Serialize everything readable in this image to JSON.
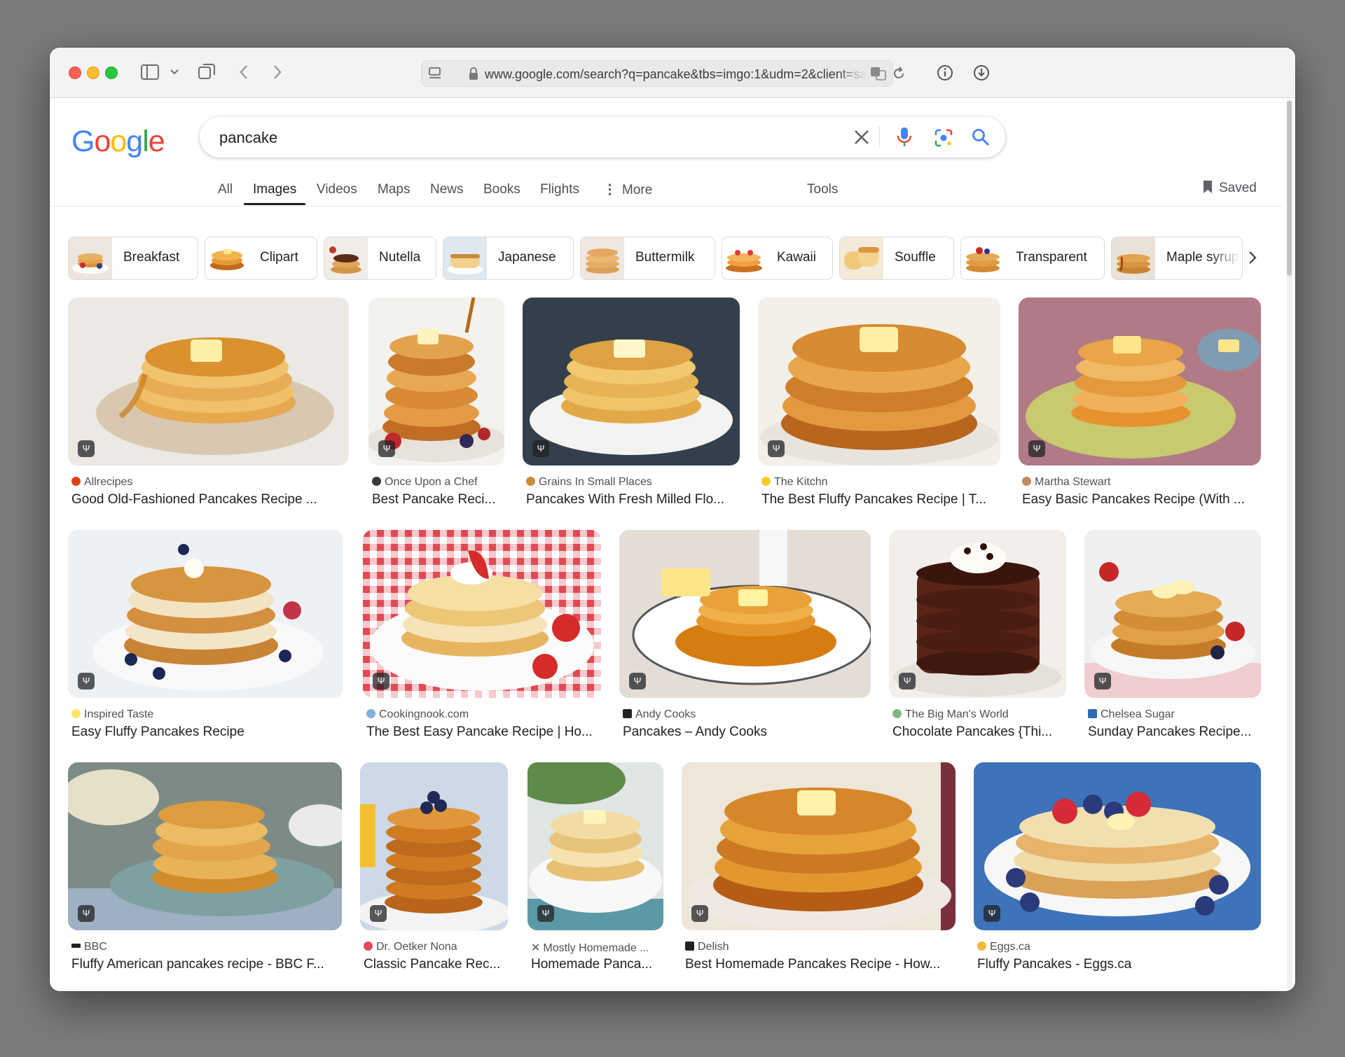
{
  "browser": {
    "url": "www.google.com/search?q=pancake&tbs=imgo:1&udm=2&client=sa"
  },
  "search": {
    "logo": [
      "G",
      "o",
      "o",
      "g",
      "l",
      "e"
    ],
    "query": "pancake"
  },
  "tabs": [
    "All",
    "Images",
    "Videos",
    "Maps",
    "News",
    "Books",
    "Flights",
    "More",
    "Tools"
  ],
  "saved_label": "Saved",
  "chips": [
    "Breakfast",
    "Clipart",
    "Nutella",
    "Japanese",
    "Buttermilk",
    "Kawaii",
    "Souffle",
    "Transparent",
    "Maple syrup"
  ],
  "results": [
    {
      "source": "Allrecipes",
      "title": "Good Old-Fashioned Pancakes Recipe ..."
    },
    {
      "source": "Once Upon a Chef",
      "title": "Best Pancake Reci..."
    },
    {
      "source": "Grains In Small Places",
      "title": "Pancakes With Fresh Milled Flo..."
    },
    {
      "source": "The Kitchn",
      "title": "The Best Fluffy Pancakes Recipe | T..."
    },
    {
      "source": "Martha Stewart",
      "title": "Easy Basic Pancakes Recipe (With ..."
    },
    {
      "source": "Inspired Taste",
      "title": "Easy Fluffy Pancakes Recipe"
    },
    {
      "source": "Cookingnook.com",
      "title": "The Best Easy Pancake Recipe | Ho..."
    },
    {
      "source": "Andy Cooks",
      "title": "Pancakes – Andy Cooks"
    },
    {
      "source": "The Big Man's World",
      "title": "Chocolate Pancakes {Thi..."
    },
    {
      "source": "Chelsea Sugar",
      "title": "Sunday Pancakes Recipe..."
    },
    {
      "source": "BBC",
      "title": "Fluffy American pancakes recipe - BBC F..."
    },
    {
      "source": "Dr. Oetker Nona",
      "title": "Classic Pancake Rec..."
    },
    {
      "source": "Mostly Homemade ...",
      "title": "Homemade Panca..."
    },
    {
      "source": "Delish",
      "title": "Best Homemade Pancakes Recipe - How..."
    },
    {
      "source": "Eggs.ca",
      "title": "Fluffy Pancakes - Eggs.ca"
    }
  ],
  "colors": {
    "google_blue": "#4285f4",
    "google_red": "#ea4335",
    "google_yellow": "#fbbc05",
    "google_green": "#34a853",
    "pancake": "#e8a53e",
    "syrup": "#c86a16",
    "chocolate": "#5a2a1c"
  }
}
